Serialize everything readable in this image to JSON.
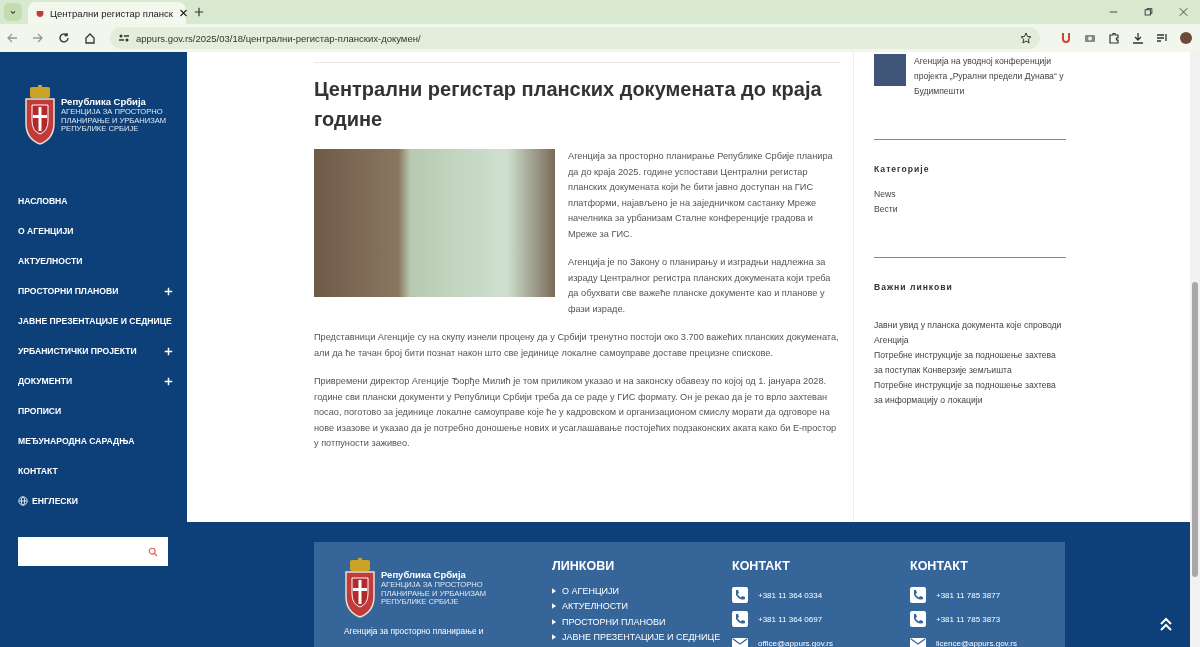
{
  "browser": {
    "tab_title": "Централни регистар планск",
    "url": "appurs.gov.rs/2025/03/18/централни-регистар-планских-докумен/"
  },
  "sidebar": {
    "logo": {
      "title": "Република Србија",
      "subtitle_lines": [
        "АГЕНЦИЈА ЗА ПРОСТОРНО",
        "ПЛАНИРАЊЕ И УРБАНИЗАМ",
        "РЕПУБЛИКЕ СРБИЈЕ"
      ]
    },
    "nav": [
      {
        "label": "НАСЛОВНА",
        "kind": "page"
      },
      {
        "label": "О АГЕНЦИЈИ",
        "kind": "page"
      },
      {
        "label": "АКТУЕЛНОСТИ",
        "kind": "page"
      },
      {
        "label": "ПРОСТОРНИ ПЛАНОВИ",
        "kind": "submenu"
      },
      {
        "label": "ЈАВНЕ ПРЕЗЕНТАЦИЈЕ И СЕДНИЦЕ",
        "kind": "page"
      },
      {
        "label": "УРБАНИСТИЧКИ ПРОЈЕКТИ",
        "kind": "submenu"
      },
      {
        "label": "ДОКУМЕНТИ",
        "kind": "submenu"
      },
      {
        "label": "ПРОПИСИ",
        "kind": "page"
      },
      {
        "label": "МЕЂУНАРОДНА САРАДЊА",
        "kind": "page"
      },
      {
        "label": "КОНТАКТ",
        "kind": "page"
      },
      {
        "label": "ЕНГЛЕСКИ",
        "kind": "language"
      }
    ]
  },
  "article": {
    "title": "Централни регистар планских докумената до краја године",
    "paragraphs": [
      "Агенција за просторно планирање Републике Србије планира да до краја 2025. године успостави Централни регистар планских докумената који ће бити јавно доступан на ГИС платформи, најављено је на заједничком састанку Мреже начелника за урбанизам Сталне конференције градова и Мреже за ГИС.",
      "Агенција је по Закону о планирању и изградњи надлежна за израду Централног регистра планских докумената који треба да обухвати све важеће планске документе као и планове у фази израде.",
      "Представници Агенције су на скупу изнели процену да у Србији тренутно постоји око 3.700 важећих планских докумената, али да ће тачан број бити познат након што све јединице локалне самоуправе доставе прецизне спискове.",
      "Привремени директор Агенције Ђорђе Милић је том приликом указао и на законску обавезу по којој од 1. јануара 2028. године сви плански документи у Републици Србији треба да се раде у ГИС формату. Он је рекао да је то врло захтеван посао, поготово за јединице локалне самоуправе које ће у кадровском и организационом смислу морати да одговоре на нове изазове и указао да је потребно доношење нових и усаглашавање постојећих подзаконских аката како би Е-простор у потпуности заживео."
    ]
  },
  "aside": {
    "recent_post": "Агенција на уводној конференцији пројекта „Рурални предели Дунава“ у Будимпешти",
    "categories": {
      "heading": "Категорије",
      "items": [
        "News",
        "Вести"
      ]
    },
    "important_links": {
      "heading": "Важни линкови",
      "items": [
        "Јавни увид у планска документа које спроводи Агенција",
        "Потребне инструкције за подношење захтева за поступак Конверзије земљишта",
        "Потребне инструкције за подношење захтева за информацију о локацији"
      ]
    }
  },
  "footer": {
    "logo": {
      "title": "Република Србија",
      "subtitle_lines": [
        "АГЕНЦИЈА ЗА ПРОСТОРНО",
        "ПЛАНИРАЊЕ И УРБАНИЗАМ",
        "РЕПУБЛИКЕ СРБИЈЕ"
      ]
    },
    "description": "Агенција за просторно планирање и",
    "links": {
      "heading": "ЛИНКОВИ",
      "items": [
        "О АГЕНЦИЈИ",
        "АКТУЕЛНОСТИ",
        "ПРОСТОРНИ ПЛАНОВИ",
        "ЈАВНЕ ПРЕЗЕНТАЦИЈЕ И СЕДНИЦЕ"
      ]
    },
    "contacts": [
      {
        "heading": "КОНТАКТ",
        "items": [
          {
            "kind": "phone",
            "text": "+381 11 364 0334"
          },
          {
            "kind": "phone",
            "text": "+381 11 364 0697"
          },
          {
            "kind": "email",
            "text": "office@appurs.gov.rs"
          }
        ]
      },
      {
        "heading": "КОНТАКТ",
        "items": [
          {
            "kind": "phone",
            "text": "+381 11 785 3877"
          },
          {
            "kind": "phone",
            "text": "+381 11 785 3873"
          },
          {
            "kind": "email",
            "text": "licence@appurs.gov.rs"
          }
        ]
      }
    ]
  }
}
